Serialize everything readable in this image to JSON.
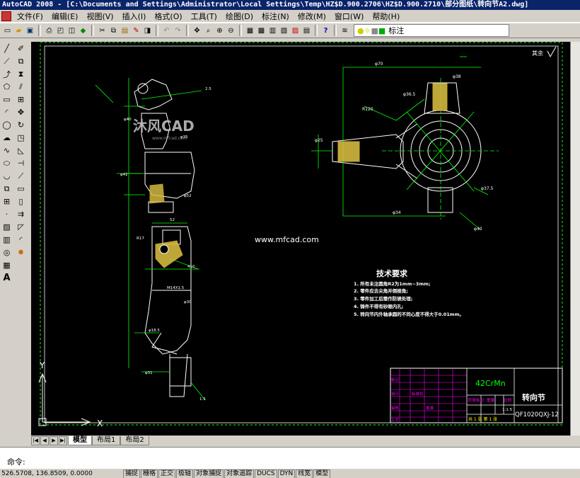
{
  "window": {
    "title": "AutoCAD 2008 - [C:\\Documents and Settings\\Administrator\\Local Settings\\Temp\\HZ$D.900.2706\\HZ$D.900.2710\\部分图纸\\转向节A2.dwg]"
  },
  "menu": [
    "文件(F)",
    "编辑(E)",
    "视图(V)",
    "插入(I)",
    "格式(O)",
    "工具(T)",
    "绘图(D)",
    "标注(N)",
    "修改(M)",
    "窗口(W)",
    "帮助(H)"
  ],
  "layer": {
    "name": "标注"
  },
  "drawing": {
    "watermark_text": "沐风CAD",
    "watermark_url": "www.mfcad.com",
    "center_url": "www.mfcad.com",
    "roughness_note": "其余",
    "tech_title": "技术要求",
    "tech_items": [
      "1. 所有未注圆角R2为1mm~3mm;",
      "2. 零件应去尖角并倒棱角;",
      "3. 零件加工后需作防锈处理;",
      "4. 铸件不得有砂眼内孔;",
      "5. 转向节内外轴承圆的不同心度不得大于0.01mm。"
    ],
    "material": "42CrMn",
    "part_name": "转向节",
    "drawing_no": "QF1020QXJ-12",
    "scale": "1:1.5",
    "sheet": "共 1 张 第 1 张"
  },
  "ucs": {
    "y": "Y",
    "x": "X"
  },
  "tabs": [
    "模型",
    "布局1",
    "布局2"
  ],
  "command": {
    "prompt": "命令:"
  },
  "status": {
    "coords": "526.5708, 136.8509, 0.0000",
    "buttons": [
      "捕捉",
      "栅格",
      "正交",
      "极轴",
      "对象捕捉",
      "对象追踪",
      "DUCS",
      "DYN",
      "线宽",
      "模型"
    ]
  },
  "colors": {
    "background": "#000000",
    "outline": "#ffffff",
    "dimension": "#00ff00",
    "hatch": "#d4b840",
    "border_dashed": "#00ff00"
  }
}
